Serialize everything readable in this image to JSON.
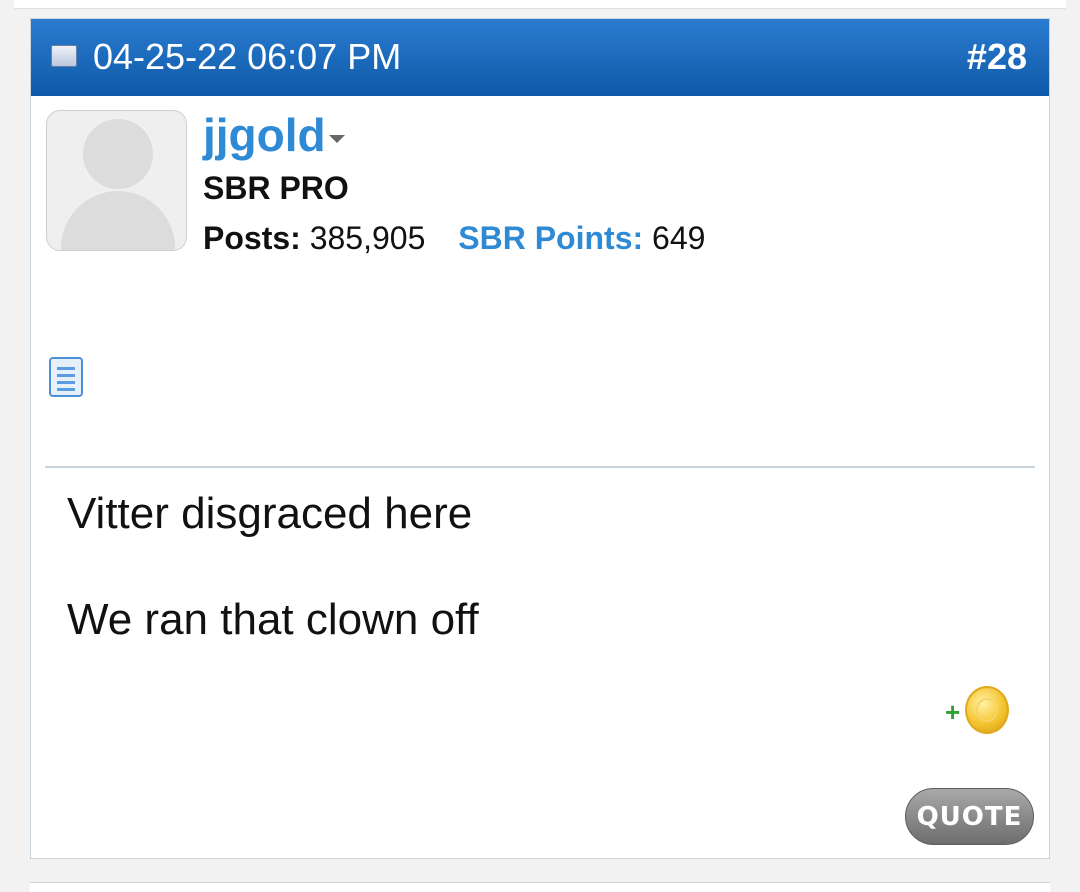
{
  "post": {
    "date": "04-25-22 06:07 PM",
    "number": "#28",
    "author": {
      "username": "jjgold",
      "title": "SBR PRO",
      "posts_label": "Posts:",
      "posts_value": "385,905",
      "points_label": "SBR Points:",
      "points_value": "649"
    },
    "body": {
      "line1": "Vitter disgraced here",
      "line2": "We ran that clown off"
    },
    "actions": {
      "quote_label": "QUOTE",
      "give_points_plus": "+"
    }
  },
  "icons": {
    "post_icon": "post-status-icon",
    "doc_icon": "document-icon",
    "coin_icon": "coin-icon",
    "caret_icon": "chevron-down-icon"
  },
  "colors": {
    "header_blue": "#1462b4",
    "link_blue": "#2f8ad6",
    "quote_gray": "#7d7d7d"
  }
}
